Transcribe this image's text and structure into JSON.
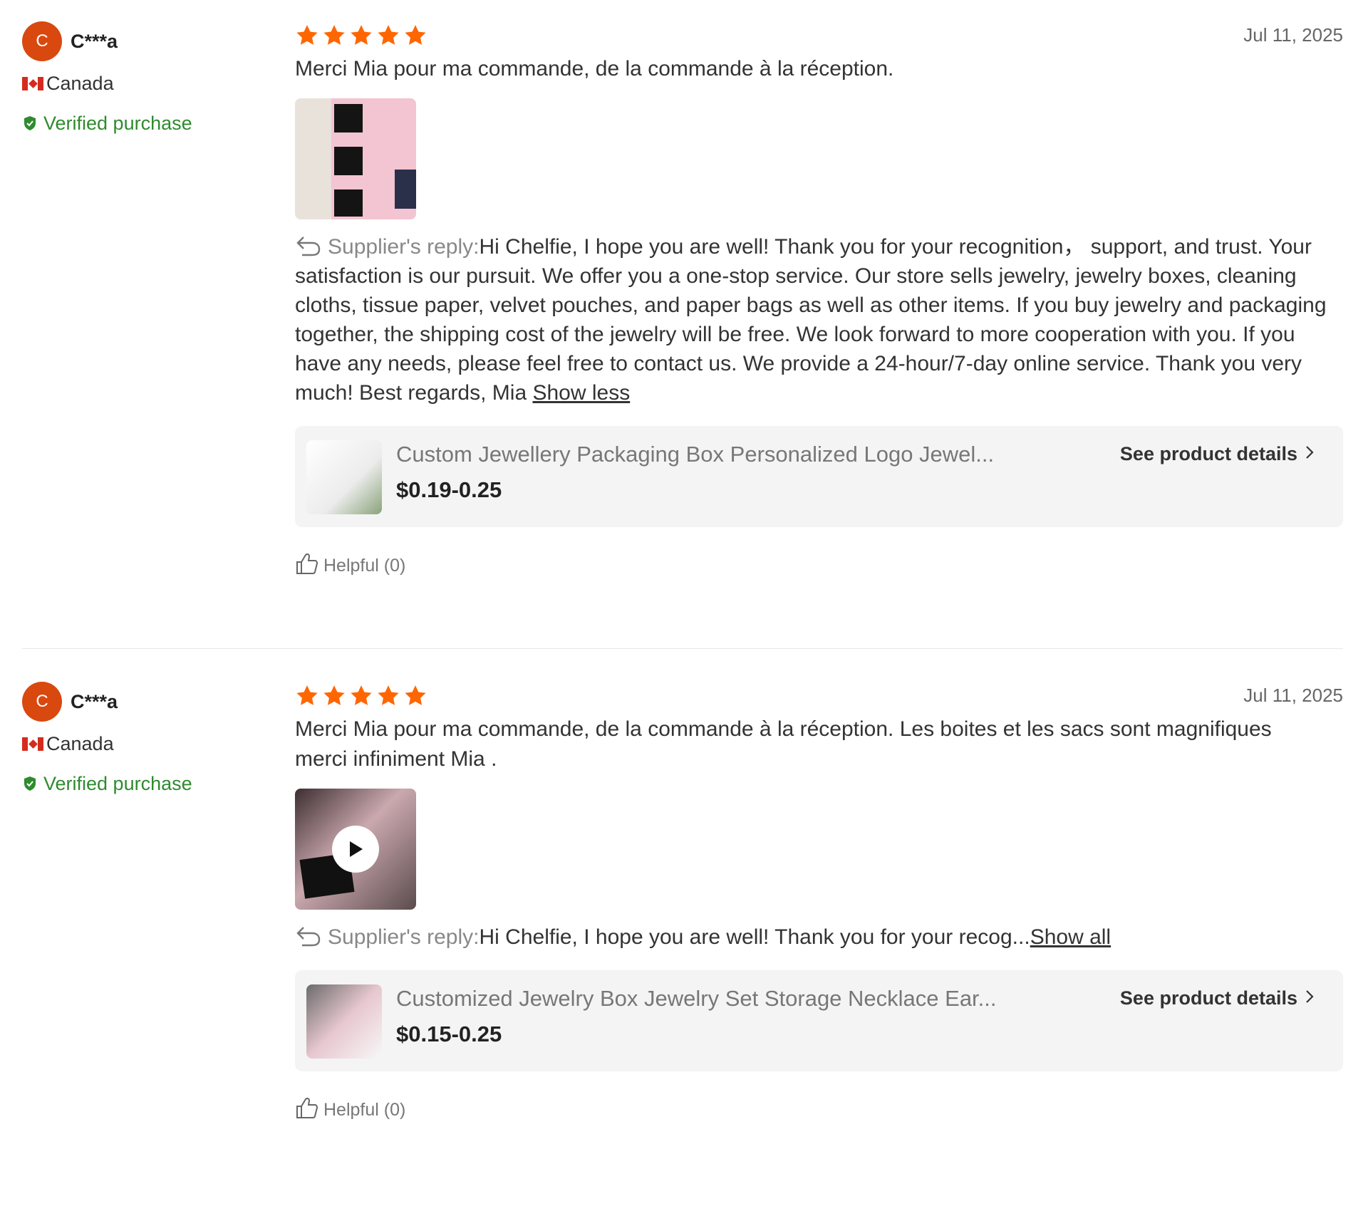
{
  "reviews": [
    {
      "avatar_letter": "C",
      "username": "C***a",
      "country": "Canada",
      "verified_label": "Verified purchase",
      "rating": 5,
      "date": "Jul 11, 2025",
      "text": "Merci Mia pour ma commande, de la commande à la réception.",
      "media_type": "photo",
      "reply_label": "Supplier's reply:",
      "reply_text": "Hi Chelfie, I hope you are well! Thank you for your recognition， support, and trust. Your satisfaction is our pursuit. We offer you a one-stop service. Our store sells jewelry, jewelry boxes, cleaning cloths, tissue paper, velvet pouches, and paper bags as well as other items. If you buy jewelry and packaging together, the shipping cost of the jewelry will be free. We look forward to more cooperation with you. If you have any needs, please feel free to contact us. We provide a 24-hour/7-day online service. Thank you very much! Best regards, Mia",
      "reply_toggle": "Show less",
      "product_title": "Custom Jewellery Packaging Box Personalized Logo Jewel...",
      "product_price": "$0.19-0.25",
      "see_details": "See product details",
      "helpful": "Helpful (0)"
    },
    {
      "avatar_letter": "C",
      "username": "C***a",
      "country": "Canada",
      "verified_label": "Verified purchase",
      "rating": 5,
      "date": "Jul 11, 2025",
      "text": "Merci Mia pour ma commande, de la commande à la réception. Les boites et les sacs sont magnifiques merci infiniment Mia .",
      "media_type": "video",
      "reply_label": "Supplier's reply:",
      "reply_text": "Hi Chelfie, I hope you are well! Thank you for your recog",
      "reply_ellipsis": "...",
      "reply_toggle": "Show all",
      "product_title": "Customized Jewelry Box Jewelry Set Storage Necklace Ear...",
      "product_price": "$0.15-0.25",
      "see_details": "See product details",
      "helpful": "Helpful (0)"
    }
  ],
  "colors": {
    "star": "#ff6600",
    "avatar": "#d9480f",
    "verified": "#2e8b2e"
  },
  "icons": {
    "star": "star-icon",
    "reply": "reply-arrow-icon",
    "chevron": "chevron-right-icon",
    "thumbs_up": "thumbs-up-icon",
    "verified": "verified-shield-icon",
    "play": "play-icon"
  }
}
